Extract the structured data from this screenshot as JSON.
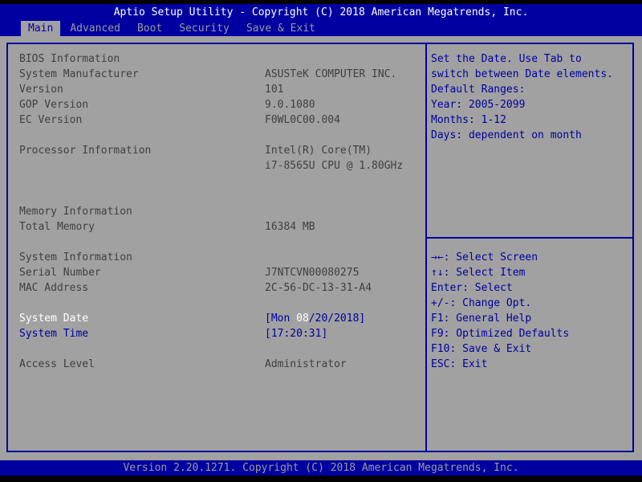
{
  "title_bar": {
    "text": "Aptio Setup Utility - Copyright (C) 2018 American Megatrends, Inc."
  },
  "tabs": [
    {
      "label": "Main",
      "active": true
    },
    {
      "label": "Advanced",
      "active": false
    },
    {
      "label": "Boot",
      "active": false
    },
    {
      "label": "Security",
      "active": false
    },
    {
      "label": "Save & Exit",
      "active": false
    }
  ],
  "main_panel": {
    "rows": [
      {
        "label": "BIOS Information",
        "value": "",
        "style": "info",
        "interactable": false
      },
      {
        "label": "System Manufacturer",
        "value": "ASUSTeK COMPUTER INC.",
        "style": "info",
        "interactable": false
      },
      {
        "label": "Version",
        "value": "101",
        "style": "info",
        "interactable": false
      },
      {
        "label": "GOP Version",
        "value": "9.0.1080",
        "style": "info",
        "interactable": false
      },
      {
        "label": "EC Version",
        "value": "F0WL0C00.004",
        "style": "info",
        "interactable": false
      },
      {
        "label": "",
        "value": "",
        "style": "blank",
        "interactable": false
      },
      {
        "label": "Processor Information",
        "value": "Intel(R) Core(TM)",
        "style": "info",
        "interactable": false
      },
      {
        "label": "",
        "value": "i7-8565U CPU @ 1.80GHz",
        "style": "info",
        "interactable": false
      },
      {
        "label": "",
        "value": "",
        "style": "blank",
        "interactable": false
      },
      {
        "label": "",
        "value": "",
        "style": "blank",
        "interactable": false
      },
      {
        "label": "Memory Information",
        "value": "",
        "style": "info",
        "interactable": false
      },
      {
        "label": "Total Memory",
        "value": "16384 MB",
        "style": "info",
        "interactable": false
      },
      {
        "label": "",
        "value": "",
        "style": "blank",
        "interactable": false
      },
      {
        "label": "System Information",
        "value": "",
        "style": "info",
        "interactable": false
      },
      {
        "label": "Serial Number",
        "value": "J7NTCVN00080275",
        "style": "info",
        "interactable": false
      },
      {
        "label": "MAC Address",
        "value": "2C-56-DC-13-31-A4",
        "style": "info",
        "interactable": false
      },
      {
        "label": "",
        "value": "",
        "style": "blank",
        "interactable": false
      },
      {
        "label": "System Date",
        "style": "selected",
        "interactable": true,
        "value_segments": [
          {
            "text": "[Mon ",
            "color": "blue"
          },
          {
            "text": "08",
            "color": "white"
          },
          {
            "text": "/20/2018]",
            "color": "blue"
          }
        ]
      },
      {
        "label": "System Time",
        "style": "editable",
        "interactable": true,
        "value_segments": [
          {
            "text": "[17:20:31]",
            "color": "blue"
          }
        ]
      },
      {
        "label": "",
        "value": "",
        "style": "blank",
        "interactable": false
      },
      {
        "label": "Access Level",
        "value": "Administrator",
        "style": "info",
        "interactable": false
      }
    ]
  },
  "help_panel": {
    "lines": [
      "Set the Date. Use Tab to",
      "switch between Date elements.",
      "Default Ranges:",
      "Year: 2005-2099",
      "Months: 1-12",
      "Days: dependent on month"
    ]
  },
  "hints": [
    {
      "keys": "→←",
      "action": "Select Screen"
    },
    {
      "keys": "↑↓",
      "action": "Select Item"
    },
    {
      "keys": "Enter",
      "action": "Select"
    },
    {
      "keys": "+/-",
      "action": "Change Opt."
    },
    {
      "keys": "F1",
      "action": "General Help"
    },
    {
      "keys": "F9",
      "action": "Optimized Defaults"
    },
    {
      "keys": "F10",
      "action": "Save & Exit"
    },
    {
      "keys": "ESC",
      "action": "Exit"
    }
  ],
  "footer": {
    "text": "Version 2.20.1271. Copyright (C) 2018 American Megatrends, Inc."
  },
  "colors": {
    "navy": "#0000a0",
    "gray": "#a1a1a1",
    "dark_text": "#404040",
    "blue_text": "#0000a0",
    "white_text": "#ffffff",
    "muted_text": "#9a9a9a"
  }
}
